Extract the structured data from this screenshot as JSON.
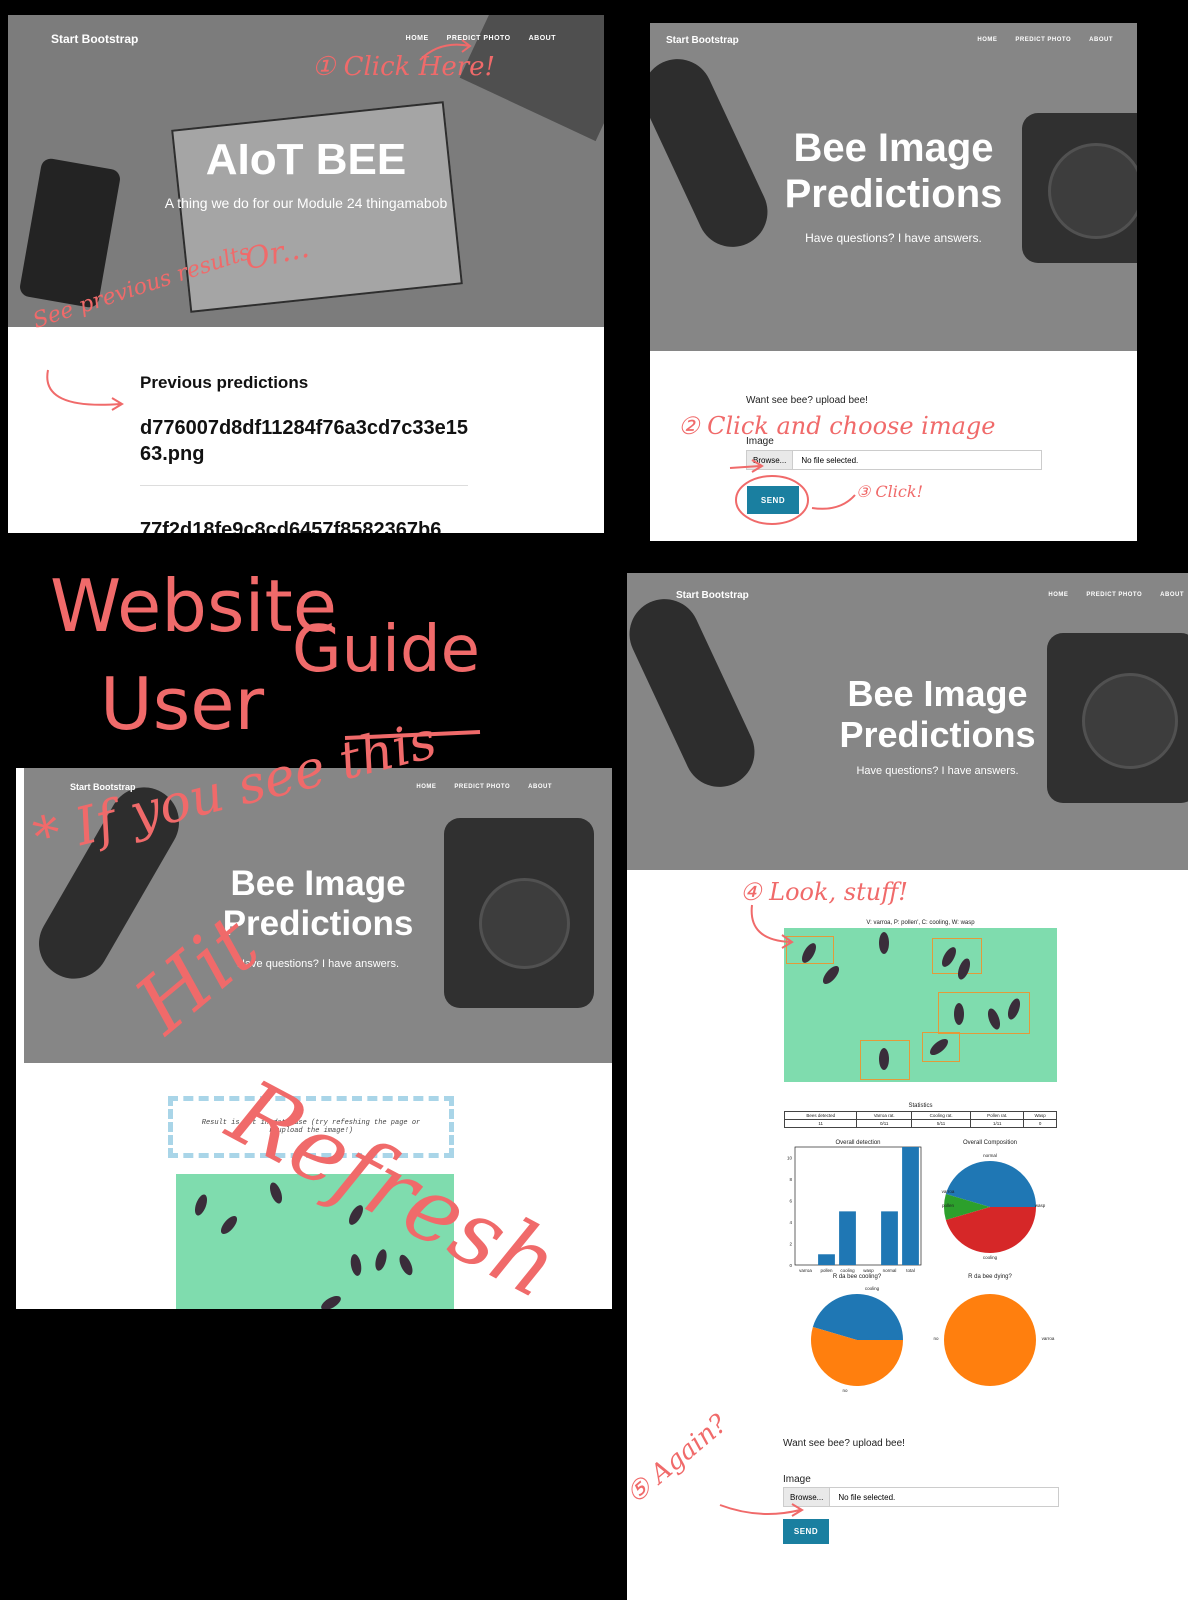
{
  "panel1": {
    "brand": "Start Bootstrap",
    "nav": [
      "HOME",
      "PREDICT PHOTO",
      "ABOUT"
    ],
    "title": "AIoT BEE",
    "subtitle": "A thing we do for our Module 24 thingamabob",
    "section_title": "Previous predictions",
    "items": [
      "d776007d8df11284f76a3cd7c33e1563.png",
      "77f2d18fe9c8cd6457f8582367b6"
    ]
  },
  "panel2": {
    "brand": "Start Bootstrap",
    "nav": [
      "HOME",
      "PREDICT PHOTO",
      "ABOUT"
    ],
    "title_line1": "Bee Image",
    "title_line2": "Predictions",
    "subtitle": "Have questions? I have answers.",
    "form_heading": "Want see bee? upload bee!",
    "image_label": "Image",
    "browse": "Browse...",
    "no_file": "No file selected.",
    "send": "SEND"
  },
  "panel3": {
    "brand": "Start Bootstrap",
    "nav": [
      "HOME",
      "PREDICT PHOTO",
      "ABOUT"
    ],
    "title_line1": "Bee Image",
    "title_line2": "Predictions",
    "subtitle": "Have questions? I have answers.",
    "result_message": "Result is not in database (try refeshing the page or reupload the image!)"
  },
  "panel4": {
    "brand": "Start Bootstrap",
    "nav": [
      "HOME",
      "PREDICT PHOTO",
      "ABOUT"
    ],
    "title_line1": "Bee Image",
    "title_line2": "Predictions",
    "subtitle": "Have questions? I have answers.",
    "image_caption": "V: varroa, P: pollen', C: cooling, W: wasp",
    "stats_title": "Statistics",
    "stats_headers": [
      "Bees detected",
      "Varroa rat.",
      "Cooling rat.",
      "Pollen rat.",
      "Wasp"
    ],
    "stats_values": [
      "11",
      "0/11",
      "5/11",
      "1/11",
      "0"
    ],
    "form_heading": "Want see bee? upload bee!",
    "image_label": "Image",
    "browse": "Browse...",
    "no_file": "No file selected.",
    "send": "SEND"
  },
  "annotations": {
    "guide_title_1": "Website",
    "guide_title_2": "User",
    "guide_title_3": "Guide",
    "step1": "① Click Here!",
    "or": "Or...",
    "see_previous": "See previous results",
    "step2": "② Click and choose image",
    "step3": "③ Click!",
    "step4": "④ Look, stuff!",
    "step5": "⑤ Again?",
    "if_you_see_this": "* If you see this",
    "hit": "Hit",
    "refresh": "Refresh"
  },
  "chart_data": [
    {
      "type": "bar",
      "title": "Overall detection",
      "categories": [
        "varroa",
        "pollen",
        "cooling",
        "wasp",
        "normal",
        "total"
      ],
      "values": [
        0,
        1,
        5,
        0,
        5,
        11
      ],
      "ylim": [
        0,
        11
      ]
    },
    {
      "type": "pie",
      "title": "Overall Composition",
      "labels": [
        "normal",
        "varroa",
        "pollen",
        "cooling",
        "wasp"
      ],
      "values": [
        5,
        0,
        1,
        5,
        0
      ],
      "colors": [
        "#1f77b4",
        "#ff7f0e",
        "#2ca02c",
        "#d62728",
        "#9467bd"
      ]
    },
    {
      "type": "pie",
      "title": "R da bee cooling?",
      "labels": [
        "cooling",
        "no"
      ],
      "values": [
        5,
        6
      ],
      "colors": [
        "#1f77b4",
        "#ff7f0e"
      ]
    },
    {
      "type": "pie",
      "title": "R da bee dying?",
      "labels": [
        "no",
        "varroa"
      ],
      "values": [
        11,
        0
      ],
      "colors": [
        "#ff7f0e",
        "#1f77b4"
      ]
    }
  ]
}
